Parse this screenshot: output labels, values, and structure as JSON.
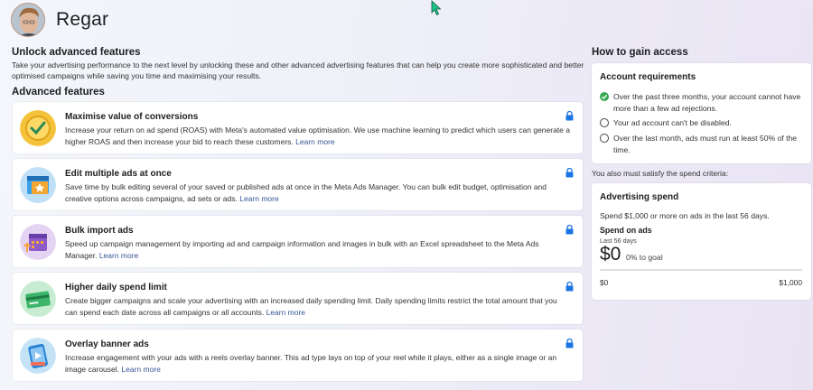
{
  "header": {
    "account_name": "Regar"
  },
  "intro": {
    "title": "Unlock advanced features",
    "description": "Take your advertising performance to the next level by unlocking these and other advanced advertising features that can help you create more sophisticated and better optimised campaigns while saving you time and maximising your results."
  },
  "features": {
    "title": "Advanced features",
    "learn_more": "Learn more",
    "items": [
      {
        "title": "Maximise value of conversions",
        "icon": "checkmark-badge-icon",
        "description": "Increase your return on ad spend (ROAS) with Meta's automated value optimisation. We use machine learning to predict which users can generate a higher ROAS and then increase your bid to reach these customers."
      },
      {
        "title": "Edit multiple ads at once",
        "icon": "star-window-icon",
        "description": "Save time by bulk editing several of your saved or published ads at once in the Meta Ads Manager. You can bulk edit budget, optimisation and creative options across campaigns, ad sets or ads."
      },
      {
        "title": "Bulk import ads",
        "icon": "calendar-upload-icon",
        "description": "Speed up campaign management by importing ad and campaign information and images in bulk with an Excel spreadsheet to the Meta Ads Manager."
      },
      {
        "title": "Higher daily spend limit",
        "icon": "credit-card-icon",
        "description": "Create bigger campaigns and scale your advertising with an increased daily spending limit. Daily spending limits restrict the total amount that you can spend each date across all campaigns or all accounts."
      },
      {
        "title": "Overlay banner ads",
        "icon": "phone-video-icon",
        "description": "Increase engagement with your ads with a reels overlay banner. This ad type lays on top of your reel while it plays, either as a single image or an image carousel."
      }
    ]
  },
  "access": {
    "title": "How to gain access",
    "requirements": {
      "title": "Account requirements",
      "items": [
        {
          "text": "Over the past three months, your account cannot have more than a few ad rejections.",
          "met": true
        },
        {
          "text": "Your ad account can't be disabled.",
          "met": false
        },
        {
          "text": "Over the last month, ads must run at least 50% of the time.",
          "met": false
        }
      ]
    },
    "spend_note": "You also must satisfy the spend criteria:",
    "spend": {
      "title": "Advertising spend",
      "description": "Spend $1,000 or more on ads in the last 56 days.",
      "label": "Spend on ads",
      "period": "Last 56 days",
      "amount": "$0",
      "goal_text": "0% to goal",
      "progress_fraction": 0,
      "range_min": "$0",
      "range_max": "$1,000"
    }
  },
  "colors": {
    "accent": "#1b74e4",
    "link": "#385898",
    "success": "#36a852",
    "lock": "#1b74e4"
  }
}
